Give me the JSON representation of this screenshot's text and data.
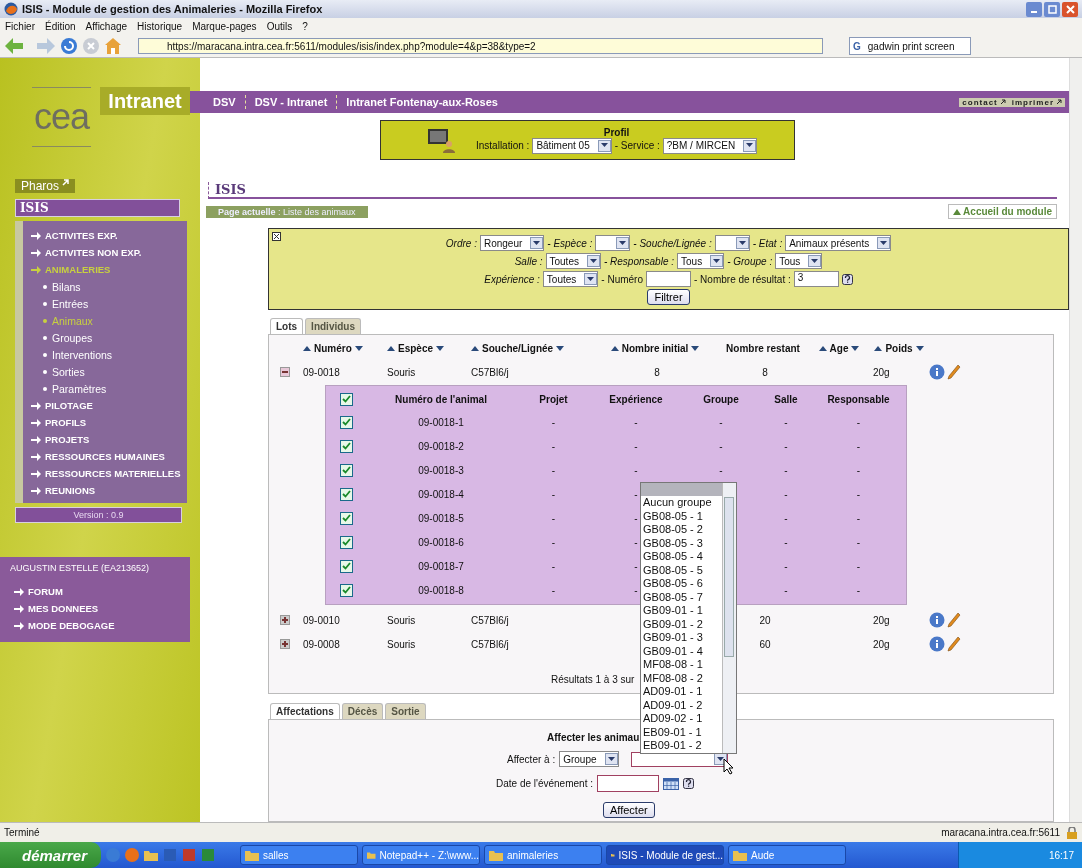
{
  "window": {
    "title": "ISIS - Module de gestion des Animaleries - Mozilla Firefox"
  },
  "menu": [
    "Fichier",
    "Édition",
    "Affichage",
    "Historique",
    "Marque-pages",
    "Outils",
    "?"
  ],
  "toolbar": {
    "url": "https://maracana.intra.cea.fr:5611/modules/isis/index.php?module=4&p=38&type=2",
    "search_engine": "G",
    "search": "gadwin print screen"
  },
  "site": {
    "logo": "cea",
    "brand": "Intranet",
    "nav": [
      "DSV",
      "DSV - Intranet",
      "Intranet Fontenay-aux-Roses"
    ],
    "links": [
      "contact",
      "imprimer"
    ]
  },
  "profile": {
    "title": "Profil",
    "fields": [
      {
        "label": "Installation :",
        "value": "Bâtiment 05"
      },
      {
        "label": "- Service :",
        "value": "?BM / MIRCEN"
      }
    ]
  },
  "sidebar": {
    "pharos": "Pharos",
    "title": "ISIS",
    "items": [
      {
        "label": "ACTIVITES EXP.",
        "selected": false
      },
      {
        "label": "ACTIVITES NON EXP.",
        "selected": false
      },
      {
        "label": "ANIMALERIES",
        "selected": true,
        "children": [
          {
            "label": "Bilans",
            "selected": false
          },
          {
            "label": "Entrées",
            "selected": false
          },
          {
            "label": "Animaux",
            "selected": true
          },
          {
            "label": "Groupes",
            "selected": false
          },
          {
            "label": "Interventions",
            "selected": false
          },
          {
            "label": "Sorties",
            "selected": false
          },
          {
            "label": "Paramètres",
            "selected": false
          }
        ]
      },
      {
        "label": "PILOTAGE",
        "selected": false
      },
      {
        "label": "PROFILS",
        "selected": false
      },
      {
        "label": "PROJETS",
        "selected": false
      },
      {
        "label": "RESSOURCES HUMAINES",
        "selected": false
      },
      {
        "label": "RESSOURCES MATERIELLES",
        "selected": false
      },
      {
        "label": "REUNIONS",
        "selected": false
      }
    ],
    "version": "Version : 0.9",
    "user": "AUGUSTIN ESTELLE (EA213652)",
    "user_items": [
      "FORUM",
      "MES DONNEES",
      "MODE DEBOGAGE"
    ]
  },
  "module": {
    "title": "ISIS",
    "breadcrumb": "**Page actuelle** : Liste des animaux",
    "home_link": "Accueil du module"
  },
  "filters": [
    [
      {
        "label": "Ordre :",
        "kind": "select",
        "value": "Rongeur"
      },
      {
        "label": "- Espèce :",
        "kind": "select"
      },
      {
        "label": "- Souche/Lignée :",
        "kind": "select"
      },
      {
        "label": "- Etat :",
        "kind": "select",
        "value": "Animaux présents"
      }
    ],
    [
      {
        "label": "Salle :",
        "kind": "select",
        "value": "Toutes"
      },
      {
        "label": "- Responsable :",
        "kind": "select",
        "value": "Tous"
      },
      {
        "label": "- Groupe :",
        "kind": "select",
        "value": "Tous"
      }
    ],
    [
      {
        "label": "Expérience :",
        "kind": "select",
        "value": "Toutes"
      },
      {
        "label": "- Numéro",
        "kind": "input"
      },
      {
        "label": "- Nombre de résultat :",
        "kind": "input",
        "value": "3"
      }
    ]
  ],
  "filter_button": "Filtrer",
  "result_tabs": [
    {
      "label": "Lots",
      "selected": true
    },
    {
      "label": "Individus",
      "selected": false
    }
  ],
  "lots": {
    "columns": [
      {
        "label": "Numéro",
        "sortable": true
      },
      {
        "label": "Espèce",
        "sortable": true
      },
      {
        "label": "Souche/Lignée",
        "sortable": true
      },
      {
        "label": "Nombre initial",
        "sortable": true
      },
      {
        "label": "Nombre restant",
        "sortable": false
      },
      {
        "label": "Age",
        "sortable": true
      },
      {
        "label": "Poids",
        "sortable": true
      }
    ],
    "rows": [
      {
        "expanded": true,
        "numero": "09-0018",
        "espece": "Souris",
        "souche": "C57Bl6/j",
        "initial": "8",
        "restant": "8",
        "poids": "20g"
      },
      {
        "expanded": false,
        "numero": "09-0010",
        "espece": "Souris",
        "souche": "C57Bl6/j",
        "restant": "20",
        "poids": "20g"
      },
      {
        "expanded": false,
        "numero": "09-0008",
        "espece": "Souris",
        "souche": "C57Bl6/j",
        "restant": "60",
        "poids": "20g"
      }
    ],
    "animals": {
      "all_checked": true,
      "columns": [
        "Numéro de l'animal",
        "Projet",
        "Expérience",
        "Groupe",
        "Salle",
        "Responsable"
      ],
      "rows": [
        {
          "checked": true,
          "numero": "09-0018-1",
          "projet": "-",
          "experience": "-",
          "groupe": "-",
          "salle": "-",
          "responsable": "-"
        },
        {
          "checked": true,
          "numero": "09-0018-2",
          "projet": "-",
          "experience": "-",
          "groupe": "-",
          "salle": "-",
          "responsable": "-"
        },
        {
          "checked": true,
          "numero": "09-0018-3",
          "projet": "-",
          "experience": "-",
          "groupe": "-",
          "salle": "-",
          "responsable": "-"
        },
        {
          "checked": true,
          "numero": "09-0018-4",
          "projet": "-",
          "experience": "-",
          "salle": "-",
          "responsable": "-"
        },
        {
          "checked": true,
          "numero": "09-0018-5",
          "projet": "-",
          "experience": "-",
          "salle": "-",
          "responsable": "-"
        },
        {
          "checked": true,
          "numero": "09-0018-6",
          "projet": "-",
          "experience": "-",
          "salle": "-",
          "responsable": "-"
        },
        {
          "checked": true,
          "numero": "09-0018-7",
          "projet": "-",
          "experience": "-",
          "salle": "-",
          "responsable": "-"
        },
        {
          "checked": true,
          "numero": "09-0018-8",
          "projet": "-",
          "experience": "-",
          "salle": "-",
          "responsable": "-"
        }
      ]
    },
    "results": "Résultats 1 à 3 sur"
  },
  "assign_tabs": [
    {
      "label": "Affectations",
      "selected": true
    },
    {
      "label": "Décès",
      "selected": false
    },
    {
      "label": "Sortie",
      "selected": false
    }
  ],
  "assign": {
    "title": "Affecter les animau",
    "target_label": "Affecter à :",
    "target_value": "Groupe",
    "date_label": "Date de l'événement :",
    "button": "Affecter"
  },
  "group_dropdown": {
    "options": [
      "Aucun groupe",
      "GB08-05 - 1",
      "GB08-05 - 2",
      "GB08-05 - 3",
      "GB08-05 - 4",
      "GB08-05 - 5",
      "GB08-05 - 6",
      "GB08-05 - 7",
      "GB09-01 - 1",
      "GB09-01 - 2",
      "GB09-01 - 3",
      "GB09-01 - 4",
      "MF08-08 - 1",
      "MF08-08 - 2",
      "AD09-01 - 1",
      "AD09-01 - 2",
      "AD09-02 - 1",
      "EB09-01 - 1",
      "EB09-01 - 2"
    ]
  },
  "status_bar": {
    "text": "Terminé",
    "host": "maracana.intra.cea.fr:5611"
  },
  "taskbar": {
    "start": "démarrer",
    "tasks": [
      {
        "label": "salles",
        "selected": false
      },
      {
        "label": "Notepad++ - Z:\\www...",
        "selected": false
      },
      {
        "label": "animaleries",
        "selected": false
      },
      {
        "label": "ISIS - Module de gest...",
        "selected": true
      },
      {
        "label": "Aude",
        "selected": false
      }
    ],
    "clock": "16:17"
  }
}
